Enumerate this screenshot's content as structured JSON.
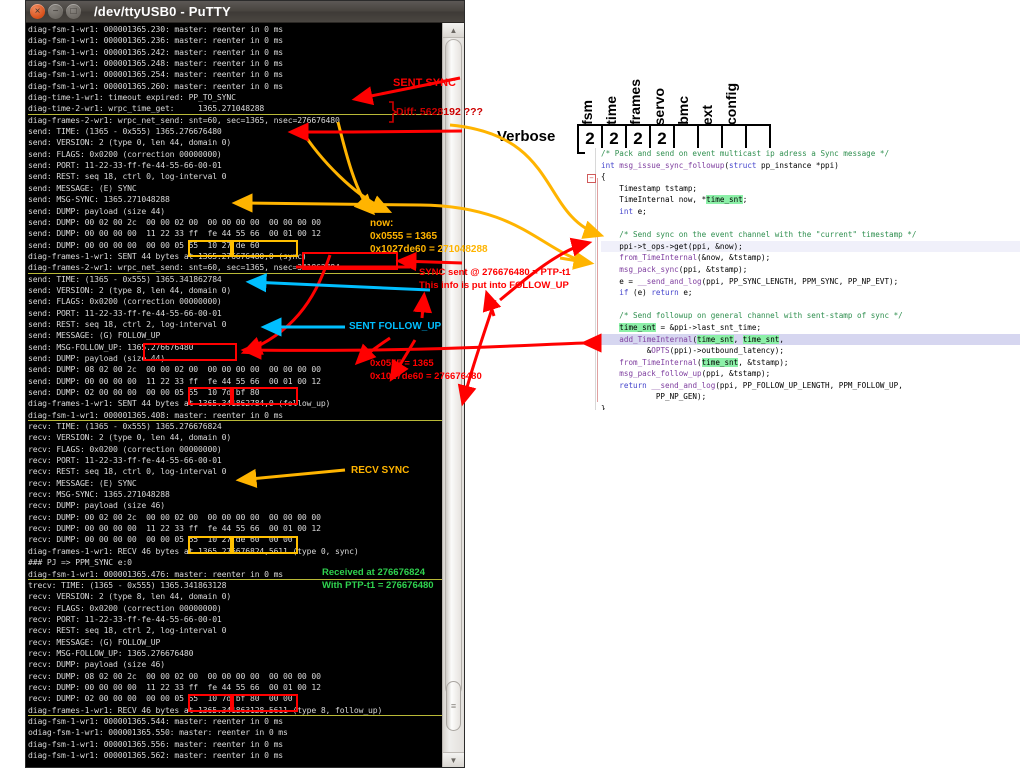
{
  "window": {
    "title": "/dev/ttyUSB0 - PuTTY",
    "buttons": {
      "close": "×",
      "minimize": "−",
      "maximize": "□"
    }
  },
  "scrollbar": {
    "up_arrow": "▲",
    "down_arrow": "▼",
    "grip": "≡"
  },
  "terminal": {
    "lines": [
      {
        "t": "diag-fsm-1-wr1: 000001365.230: master: reenter in 0 ms"
      },
      {
        "t": "diag-fsm-1-wr1: 000001365.236: master: reenter in 0 ms"
      },
      {
        "t": "diag-fsm-1-wr1: 000001365.242: master: reenter in 0 ms"
      },
      {
        "t": "diag-fsm-1-wr1: 000001365.248: master: reenter in 0 ms"
      },
      {
        "t": "diag-fsm-1-wr1: 000001365.254: master: reenter in 0 ms"
      },
      {
        "t": "diag-fsm-1-wr1: 000001365.260: master: reenter in 0 ms"
      },
      {
        "t": "diag-time-1-wr1: timeout expired: PP_TO_SYNC"
      },
      {
        "t": "diag-time-2-wr1: wrpc_time_get:     1365.271048288",
        "u": true
      },
      {
        "t": "diag-frames-2-wr1: wrpc_net_send: snt=60, sec=1365, nsec=276676480"
      },
      {
        "t": "send: TIME: (1365 - 0x555) 1365.276676480"
      },
      {
        "t": "send: VERSION: 2 (type 0, len 44, domain 0)"
      },
      {
        "t": "send: FLAGS: 0x0200 (correction 00000000)"
      },
      {
        "t": "send: PORT: 11-22-33-ff-fe-44-55-66-00-01"
      },
      {
        "t": "send: REST: seq 18, ctrl 0, log-interval 0"
      },
      {
        "t": "send: MESSAGE: (E) SYNC"
      },
      {
        "t": "send: MSG-SYNC: 1365.271048288"
      },
      {
        "t": "send: DUMP: payload (size 44)"
      },
      {
        "t": "send: DUMP: 00 02 00 2c  00 00 02 00  00 00 00 00  00 00 00 00"
      },
      {
        "t": "send: DUMP: 00 00 00 00  11 22 33 ff  fe 44 55 66  00 01 00 12"
      },
      {
        "t": "send: DUMP: 00 00 00 00  00 00 05 55  10 27 de 60"
      },
      {
        "t": "diag-frames-1-wr1: SENT 44 bytes at 1365.276676480,0 (sync)"
      },
      {
        "t": "diag-frames-2-wr1: wrpc_net_send: snt=60, sec=1365, nsec=341862784",
        "u": true
      },
      {
        "t": "send: TIME: (1365 - 0x555) 1365.341862784"
      },
      {
        "t": "send: VERSION: 2 (type 8, len 44, domain 0)"
      },
      {
        "t": "send: FLAGS: 0x0200 (correction 00000000)"
      },
      {
        "t": "send: PORT: 11-22-33-ff-fe-44-55-66-00-01"
      },
      {
        "t": "send: REST: seq 18, ctrl 2, log-interval 0"
      },
      {
        "t": "send: MESSAGE: (G) FOLLOW_UP"
      },
      {
        "t": "send: MSG-FOLLOW_UP: 1365.276676480"
      },
      {
        "t": "send: DUMP: payload (size 44)"
      },
      {
        "t": "send: DUMP: 08 02 00 2c  00 00 02 00  00 00 00 00  00 00 00 00"
      },
      {
        "t": "send: DUMP: 00 00 00 00  11 22 33 ff  fe 44 55 66  00 01 00 12"
      },
      {
        "t": "send: DUMP: 02 00 00 00  00 00 05 55  10 7d bf 80"
      },
      {
        "t": "diag-frames-1-wr1: SENT 44 bytes at 1365.341862784,0 (follow_up)"
      },
      {
        "t": "diag-fsm-1-wr1: 000001365.408: master: reenter in 0 ms",
        "u": true
      },
      {
        "t": "recv: TIME: (1365 - 0x555) 1365.276676824"
      },
      {
        "t": "recv: VERSION: 2 (type 0, len 44, domain 0)"
      },
      {
        "t": "recv: FLAGS: 0x0200 (correction 00000000)"
      },
      {
        "t": "recv: PORT: 11-22-33-ff-fe-44-55-66-00-01"
      },
      {
        "t": "recv: REST: seq 18, ctrl 0, log-interval 0"
      },
      {
        "t": "recv: MESSAGE: (E) SYNC"
      },
      {
        "t": "recv: MSG-SYNC: 1365.271048288"
      },
      {
        "t": "recv: DUMP: payload (size 46)"
      },
      {
        "t": "recv: DUMP: 00 02 00 2c  00 00 02 00  00 00 00 00  00 00 00 00"
      },
      {
        "t": "recv: DUMP: 00 00 00 00  11 22 33 ff  fe 44 55 66  00 01 00 12"
      },
      {
        "t": "recv: DUMP: 00 00 00 00  00 00 05 55  10 27 de 60  00 00"
      },
      {
        "t": "diag-frames-1-wr1: RECV 46 bytes at 1365.276676824,5611 (type 0, sync)"
      },
      {
        "t": "### PJ => PPM_SYNC e:0"
      },
      {
        "t": "diag-fsm-1-wr1: 000001365.476: master: reenter in 0 ms",
        "u": true
      },
      {
        "t": "trecv: TIME: (1365 - 0x555) 1365.341863128"
      },
      {
        "t": "recv: VERSION: 2 (type 8, len 44, domain 0)"
      },
      {
        "t": "recv: FLAGS: 0x0200 (correction 00000000)"
      },
      {
        "t": "recv: PORT: 11-22-33-ff-fe-44-55-66-00-01"
      },
      {
        "t": "recv: REST: seq 18, ctrl 2, log-interval 0"
      },
      {
        "t": "recv: MESSAGE: (G) FOLLOW_UP"
      },
      {
        "t": "recv: MSG-FOLLOW_UP: 1365.276676480"
      },
      {
        "t": "recv: DUMP: payload (size 46)"
      },
      {
        "t": "recv: DUMP: 08 02 00 2c  00 00 02 00  00 00 00 00  00 00 00 00"
      },
      {
        "t": "recv: DUMP: 00 00 00 00  11 22 33 ff  fe 44 55 66  00 01 00 12"
      },
      {
        "t": "recv: DUMP: 02 00 00 00  00 00 05 55  10 7d bf 80  00 00"
      },
      {
        "t": "diag-frames-1-wr1: RECV 46 bytes at 1365.341863128,5611 (type 8, follow_up)",
        "u": true
      },
      {
        "t": "diag-fsm-1-wr1: 000001365.544: master: reenter in 0 ms"
      },
      {
        "t": "odiag-fsm-1-wr1: 000001365.550: master: reenter in 0 ms"
      },
      {
        "t": "diag-fsm-1-wr1: 000001365.556: master: reenter in 0 ms"
      },
      {
        "t": "diag-fsm-1-wr1: 000001365.562: master: reenter in 0 ms"
      }
    ]
  },
  "verbose": {
    "label": "Verbose",
    "columns": [
      "fsm",
      "time",
      "frames",
      "servo",
      "bmc",
      "ext",
      "config"
    ],
    "values": [
      "2",
      "2",
      "2",
      "2",
      "",
      "",
      "",
      ""
    ]
  },
  "annotations": {
    "sent_sync": "SENT SYNC",
    "diff": "Diff: 5628192 ???",
    "now_label": "now:",
    "now_hex1": "0x0555 = 1365",
    "now_hex2": "0x1027de60 = 271048288",
    "sync_sent_1": "SYNC sent @ 276676480 = PTP-t1",
    "sync_sent_2": "This info is put into FOLLOW_UP",
    "sent_follow_up": "SENT FOLLOW_UP",
    "fu_hex1": "0x0555 = 1365",
    "fu_hex2": "0x1027de60 = 276676480",
    "recv_sync": "RECV SYNC",
    "received_1": "Received at 276676824",
    "received_2": "With PTP-t1 = 276676480"
  },
  "code": {
    "lines": [
      "/* Pack and send on event multicast ip adress a Sync message */",
      "int msg_issue_sync_followup(struct pp_instance *ppi)",
      "{",
      "    Timestamp tstamp;",
      "    TimeInternal now, *time_snt;",
      "    int e;",
      "",
      "    /* Send sync on the event channel with the \"current\" timestamp */",
      "    ppi->t_ops->get(ppi, &now);",
      "    from_TimeInternal(&now, &tstamp);",
      "    msg_pack_sync(ppi, &tstamp);",
      "    e = __send_and_log(ppi, PP_SYNC_LENGTH, PPM_SYNC, PP_NP_EVT);",
      "    if (e) return e;",
      "",
      "    /* Send followup on general channel with sent-stamp of sync */",
      "    time_snt = &ppi->last_snt_time;",
      "    add_TimeInternal(time_snt, time_snt,",
      "          &OPTS(ppi)->outbound_latency);",
      "    from_TimeInternal(time_snt, &tstamp);",
      "    msg_pack_follow_up(ppi, &tstamp);",
      "    return __send_and_log(ppi, PP_FOLLOW_UP_LENGTH, PPM_FOLLOW_UP,",
      "            PP_NP_GEN);",
      "}"
    ],
    "fold_glyph": "−"
  },
  "colors": {
    "red": "#ff0000",
    "orange": "#ffb400",
    "cyan": "#00bfff",
    "green": "#2fd24f",
    "terminal_bg": "#000000",
    "terminal_fg": "#d8d8d8"
  }
}
